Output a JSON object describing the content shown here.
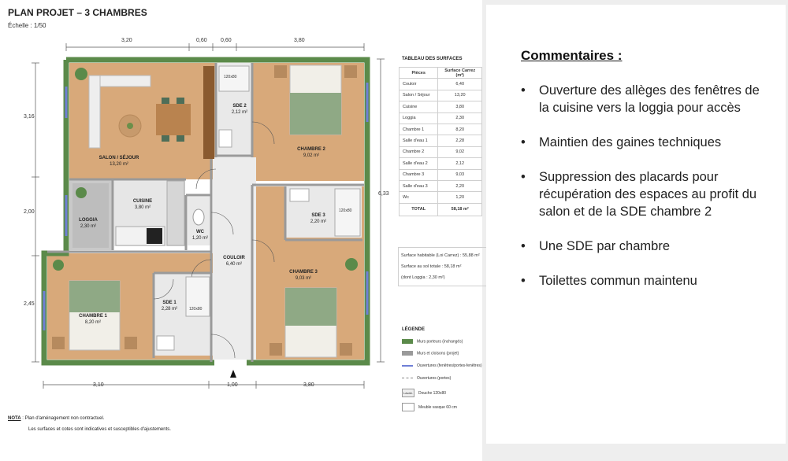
{
  "plan": {
    "title": "PLAN PROJET – 3 CHAMBRES",
    "scale": "Échelle : 1/50",
    "dims_top": [
      "3,20",
      "0,60",
      "0,60",
      "3,80"
    ],
    "dims_left": [
      "3,16",
      "2,00",
      "2,45"
    ],
    "dim_right": "6,33",
    "dims_bottom": [
      "3,10",
      "1,00",
      "3,80"
    ],
    "rooms": {
      "salon": {
        "name": "SALON / SÉJOUR",
        "area": "13,20 m²"
      },
      "sde2": {
        "name": "SDE 2",
        "area": "2,12 m²"
      },
      "chambre2": {
        "name": "CHAMBRE 2",
        "area": "9,02 m²"
      },
      "cuisine": {
        "name": "CUISINE",
        "area": "3,80 m²"
      },
      "loggia": {
        "name": "LOGGIA",
        "area": "2,30 m²"
      },
      "wc": {
        "name": "WC",
        "area": "1,20 m²"
      },
      "sde3": {
        "name": "SDE 3",
        "area": "2,20 m²"
      },
      "couloir": {
        "name": "COULOIR",
        "area": "6,40 m²"
      },
      "chambre3": {
        "name": "CHAMBRE 3",
        "area": "9,03 m²"
      },
      "chambre1": {
        "name": "CHAMBRE 1",
        "area": "8,20 m²"
      },
      "sde1": {
        "name": "SDE 1",
        "area": "2,28 m²"
      }
    },
    "shower_label": "120x80",
    "surfaces": {
      "title": "TABLEAU DES SURFACES",
      "headers": [
        "Pièces",
        "Surface Carrez (m²)"
      ],
      "rows": [
        [
          "Couloir",
          "6,40"
        ],
        [
          "Salon / Séjour",
          "13,20"
        ],
        [
          "Cuisine",
          "3,80"
        ],
        [
          "Loggia",
          "2,30"
        ],
        [
          "Chambre 1",
          "8,20"
        ],
        [
          "Salle d'eau 1",
          "2,28"
        ],
        [
          "Chambre 2",
          "9,02"
        ],
        [
          "Salle d'eau 2",
          "2,12"
        ],
        [
          "Chambre 3",
          "9,03"
        ],
        [
          "Salle d'eau 3",
          "2,20"
        ],
        [
          "Wc",
          "1,20"
        ]
      ],
      "total_label": "TOTAL",
      "total_value": "58,18 m²"
    },
    "summary": [
      "Surface habitable (Loi Carrez) : 55,88 m²",
      "Surface au sol totale : 58,18 m²",
      "(dont Loggia : 2,30 m²)"
    ],
    "legend": {
      "title": "LÉGENDE",
      "items": [
        "Murs porteurs (inchangés)",
        "Murs et cloisons (projet)",
        "Ouvertures (fenêtres/portes-fenêtres)",
        "Ouvertures (portes)",
        "Douche 120x80",
        "Meuble vasque 60 cm"
      ],
      "shower_tag": "Lavab.",
      "colors": {
        "walls": "#5b8a4a",
        "partitions": "#9a9a9a",
        "windows": "#6f7fd6"
      }
    },
    "note_label": "NOTA",
    "note_text": " : Plan d'aménagement non contractuel.",
    "note_text2": "Les surfaces et cotes sont indicatives et susceptibles d'ajustements."
  },
  "comments": {
    "title": "Commentaires :",
    "items": [
      "Ouverture des allèges des fenêtres de la cuisine vers la loggia pour accès",
      "Maintien des gaines techniques",
      "Suppression des placards pour récupération des espaces au profit du salon et de la SDE chambre 2",
      "Une SDE par chambre",
      "Toilettes commun maintenu"
    ]
  }
}
